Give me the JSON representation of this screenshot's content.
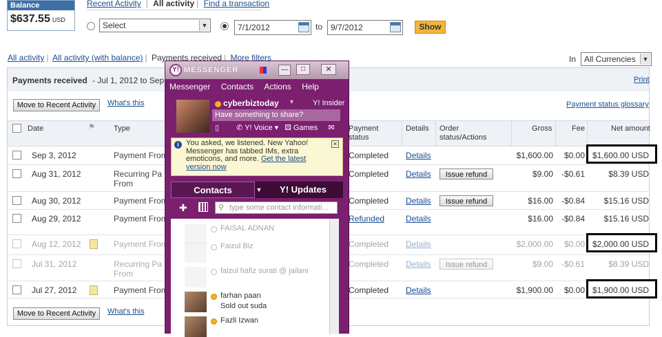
{
  "balance": {
    "label": "Balance",
    "amount": "$637.55",
    "currency": "USD"
  },
  "topnav": {
    "recent": "Recent Activity",
    "all": "All activity",
    "find": "Find a transaction"
  },
  "filter": {
    "select_value": "Select",
    "date_from": "7/1/2012",
    "to_label": "to",
    "date_to": "9/7/2012",
    "show": "Show"
  },
  "subnav": {
    "all_activity": "All activity",
    "all_with_balance": "All activity (with balance)",
    "payments_received": "Payments received",
    "more_filters": "More filters",
    "in_label": "In",
    "currency": "All Currencies"
  },
  "panel": {
    "title": "Payments received",
    "range": "- Jul 1, 2012 to Sep",
    "print": "Print",
    "move_btn": "Move to Recent Activity",
    "whats_this": "What's this",
    "glossary": "Payment status glossary"
  },
  "columns": {
    "date": "Date",
    "type": "Type",
    "status": "Payment status",
    "details": "Details",
    "order": "Order status/Actions",
    "gross": "Gross",
    "fee": "Fee",
    "net": "Net amount"
  },
  "rows": [
    {
      "date": "Sep 3, 2012",
      "type": "Payment From",
      "type2": "",
      "status": "Completed",
      "details": "Details",
      "action": "",
      "gross": "$1,600.00",
      "fee": "$0.00",
      "net": "$1,600.00 USD",
      "dim": false,
      "highlight": true,
      "note": false
    },
    {
      "date": "Aug 31, 2012",
      "type": "Recurring Pa",
      "type2": "From",
      "status": "Completed",
      "details": "Details",
      "action": "Issue refund",
      "gross": "$9.00",
      "fee": "-$0.61",
      "net": "$8.39 USD",
      "dim": false,
      "highlight": false,
      "note": false
    },
    {
      "date": "Aug 30, 2012",
      "type": "Payment From",
      "type2": "",
      "status": "Completed",
      "details": "Details",
      "action": "Issue refund",
      "gross": "$16.00",
      "fee": "-$0.84",
      "net": "$15.16 USD",
      "dim": false,
      "highlight": false,
      "note": false
    },
    {
      "date": "Aug 29, 2012",
      "type": "Payment From",
      "type2": "",
      "status": "Refunded",
      "details": "Details",
      "action": "",
      "gross": "$16.00",
      "fee": "-$0.84",
      "net": "$15.16 USD",
      "dim": false,
      "highlight": false,
      "note": false
    },
    {
      "date": "Aug 12, 2012",
      "type": "Payment From",
      "type2": "",
      "status": "Completed",
      "details": "Details",
      "action": "",
      "gross": "$2,000.00",
      "fee": "$0.00",
      "net": "$2,000.00 USD",
      "dim": true,
      "highlight": true,
      "note": true
    },
    {
      "date": "Jul 31, 2012",
      "type": "Recurring Pa",
      "type2": "From",
      "status": "Completed",
      "details": "Details",
      "action": "Issue refund",
      "gross": "$9.00",
      "fee": "-$0.61",
      "net": "$8.39 USD",
      "dim": true,
      "highlight": false,
      "note": false
    },
    {
      "date": "Jul 27, 2012",
      "type": "Payment From",
      "type2": "",
      "status": "Completed",
      "details": "Details",
      "action": "",
      "gross": "$1,900.00",
      "fee": "$0.00",
      "net": "$1,900.00 USD",
      "dim": false,
      "highlight": true,
      "note": true
    }
  ],
  "messenger": {
    "title": "MESSENGER",
    "menu": [
      "Messenger",
      "Contacts",
      "Actions",
      "Help"
    ],
    "username": "cyberbiztoday",
    "insider": "Insider",
    "status_placeholder": "Have something to share?",
    "voice": "Y! Voice",
    "games": "Games",
    "notice": "You asked, we listened.  New Yahoo! Messenger has tabbed IMs, extra emoticons, and more.",
    "notice_link": "Get the latest version now",
    "tab_contacts": "Contacts",
    "tab_updates": "Y! Updates",
    "search_placeholder": "type some contact informati...",
    "contacts": [
      {
        "name": "FAISAL ADNAN",
        "sub": "",
        "online": false
      },
      {
        "name": "Faizul Biz",
        "sub": "",
        "online": false
      },
      {
        "name": "faizul hafiz surati @ jailani",
        "sub": "",
        "online": false
      },
      {
        "name": "farhan paan",
        "sub": "Sold out suda",
        "online": true
      },
      {
        "name": "Fazli Izwan",
        "sub": "",
        "online": true
      }
    ]
  },
  "colors": {
    "accent": "#1a4d8f",
    "show_btn": "#f5b53a",
    "messenger": "#7b1f6f",
    "online": "#f3b21b"
  }
}
